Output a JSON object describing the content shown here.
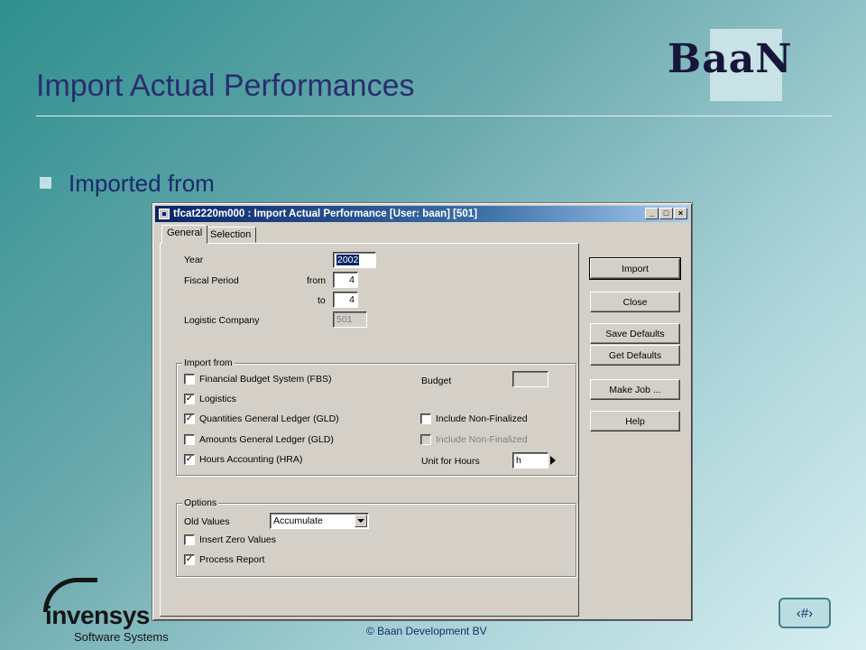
{
  "slide": {
    "title": "Import Actual Performances",
    "bullet": "Imported from",
    "logo_brand": "BaaN",
    "footer_logo_name": "invensys",
    "footer_logo_sub": "Software Systems",
    "copyright": "© Baan Development BV",
    "page_number": "‹#›"
  },
  "window": {
    "title": "tfcat2220m000 : Import Actual Performance [User: baan] [501]",
    "controls": {
      "minimize": "_",
      "maximize": "□",
      "close": "×"
    },
    "tabs": [
      {
        "label": "General",
        "active": true
      },
      {
        "label": "Selection",
        "active": false
      }
    ],
    "form": {
      "year_label": "Year",
      "year_value": "2002",
      "fiscal_period_label": "Fiscal Period",
      "from_label": "from",
      "from_value": "4",
      "to_label": "to",
      "to_value": "4",
      "logistic_company_label": "Logistic Company",
      "logistic_company_value": "501"
    },
    "import_from": {
      "group_label": "Import from",
      "checkboxes": [
        {
          "label": "Financial Budget System (FBS)",
          "checked": false,
          "mark": ""
        },
        {
          "label": "Logistics",
          "checked": true,
          "mark": "✓"
        },
        {
          "label": "Quantities General Ledger (GLD)",
          "checked": true,
          "mark": "✓"
        },
        {
          "label": "Amounts General Ledger (GLD)",
          "checked": false,
          "mark": ""
        },
        {
          "label": "Hours Accounting (HRA)",
          "checked": true,
          "mark": "✓"
        }
      ],
      "budget_label": "Budget",
      "budget_value": "",
      "include_non_finalized_1": {
        "label": "Include Non-Finalized",
        "checked": false,
        "mark": ""
      },
      "include_non_finalized_2": {
        "label": "Include Non-Finalized",
        "checked": false,
        "disabled": true,
        "mark": ""
      },
      "unit_for_hours_label": "Unit for Hours",
      "unit_for_hours_value": "h"
    },
    "options": {
      "group_label": "Options",
      "old_values_label": "Old Values",
      "old_values_selected": "Accumulate",
      "insert_zero_values": {
        "label": "Insert Zero Values",
        "checked": false,
        "mark": ""
      },
      "process_report": {
        "label": "Process Report",
        "checked": true,
        "mark": "✓"
      }
    },
    "buttons": {
      "import": "Import",
      "close": "Close",
      "save_defaults": "Save Defaults",
      "get_defaults": "Get Defaults",
      "make_job": "Make Job ...",
      "help": "Help"
    }
  }
}
